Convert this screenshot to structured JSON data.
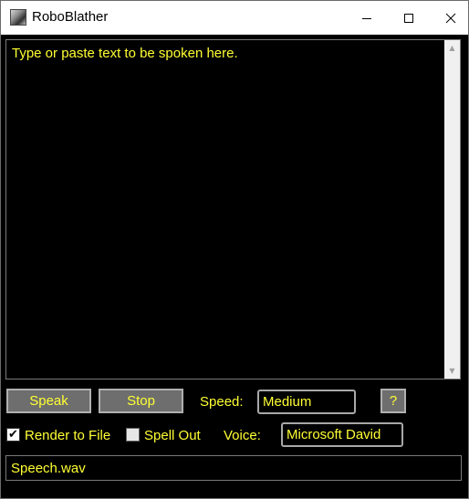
{
  "window": {
    "title": "RoboBlather",
    "icon": "app-portrait-icon",
    "controls": [
      "minimize-icon",
      "maximize-icon",
      "close-icon"
    ]
  },
  "textarea": {
    "placeholder": "Type or paste text to be spoken here."
  },
  "buttons": {
    "speak": "Speak",
    "stop": "Stop",
    "help": "?"
  },
  "speed": {
    "label": "Speed:",
    "value": "Medium"
  },
  "options": {
    "render_to_file": {
      "label": "Render to File",
      "checked": true
    },
    "spell_out": {
      "label": "Spell Out",
      "checked": false
    }
  },
  "voice": {
    "label": "Voice:",
    "value": "Microsoft David"
  },
  "output_file": "Speech.wav",
  "colors": {
    "text": "#ffff33",
    "background": "#000000",
    "button": "#6e6e6e"
  }
}
